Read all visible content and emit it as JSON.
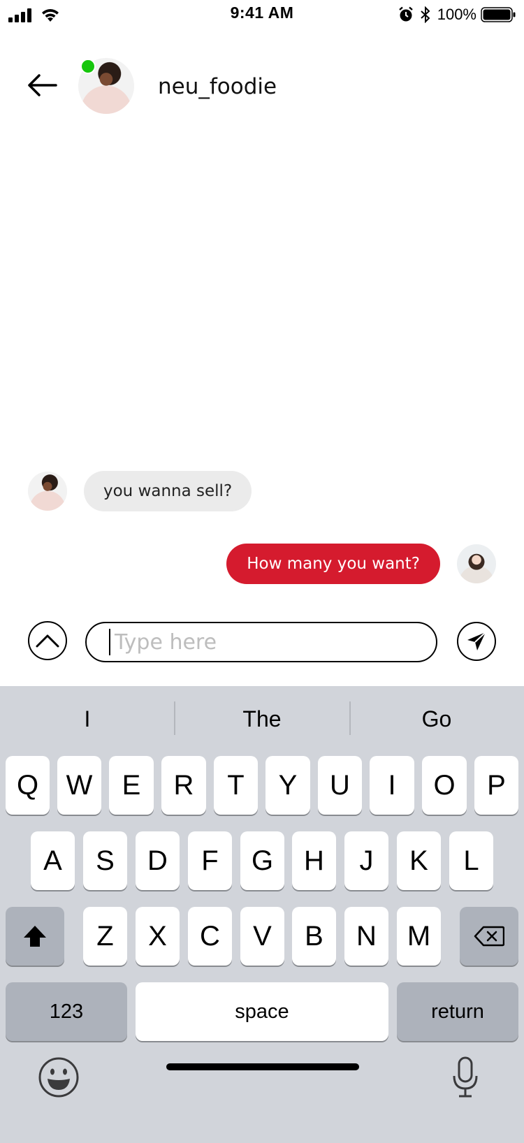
{
  "status_bar": {
    "time": "9:41 AM",
    "battery": "100%"
  },
  "header": {
    "username": "neu_foodie",
    "online": true
  },
  "messages": [
    {
      "from": "them",
      "text": "you wanna sell?"
    },
    {
      "from": "me",
      "text": "How many you want?"
    }
  ],
  "composer": {
    "placeholder": "Type here"
  },
  "keyboard": {
    "suggestions": [
      "I",
      "The",
      "Go"
    ],
    "row1": [
      "Q",
      "W",
      "E",
      "R",
      "T",
      "Y",
      "U",
      "I",
      "O",
      "P"
    ],
    "row2": [
      "A",
      "S",
      "D",
      "F",
      "G",
      "H",
      "J",
      "K",
      "L"
    ],
    "row3": [
      "Z",
      "X",
      "C",
      "V",
      "B",
      "N",
      "M"
    ],
    "numbers_label": "123",
    "space_label": "space",
    "return_label": "return"
  },
  "colors": {
    "accent": "#d51b2e",
    "online": "#16c60c",
    "incoming_bubble": "#ebebeb",
    "keyboard_bg": "#d1d4da"
  }
}
